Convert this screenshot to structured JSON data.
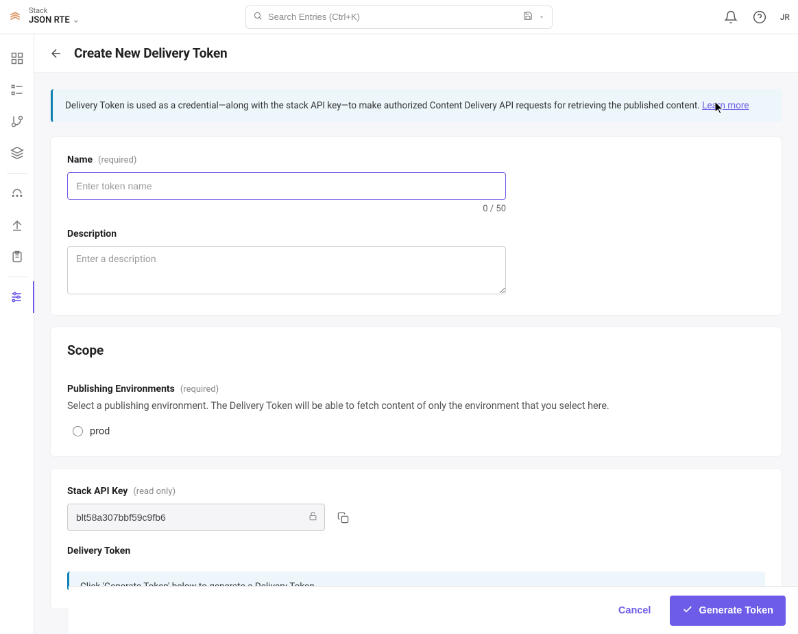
{
  "topbar": {
    "stack_label": "Stack",
    "stack_name": "JSON RTE",
    "search_placeholder": "Search Entries (Ctrl+K)",
    "avatar": "JR"
  },
  "page": {
    "title": "Create New Delivery Token"
  },
  "banner": {
    "text": "Delivery Token is used as a credential—along with the stack API key—to make authorized Content Delivery API requests for retrieving the published content. ",
    "link": "Learn more"
  },
  "form": {
    "name_label": "Name",
    "name_hint": "(required)",
    "name_placeholder": "Enter token name",
    "name_count": "0 / 50",
    "desc_label": "Description",
    "desc_placeholder": "Enter a description"
  },
  "scope": {
    "title": "Scope",
    "env_label": "Publishing Environments",
    "env_hint": "(required)",
    "env_desc": "Select a publishing environment. The Delivery Token will be able to fetch content of only the environment that you select here.",
    "options": [
      "prod"
    ]
  },
  "apikey": {
    "label": "Stack API Key",
    "hint": "(read only)",
    "value": "blt58a307bbf59c9fb6"
  },
  "delivery": {
    "label": "Delivery Token",
    "banner": "Click 'Generate Token' below to generate a Delivery Token."
  },
  "footer": {
    "cancel": "Cancel",
    "generate": "Generate Token"
  }
}
